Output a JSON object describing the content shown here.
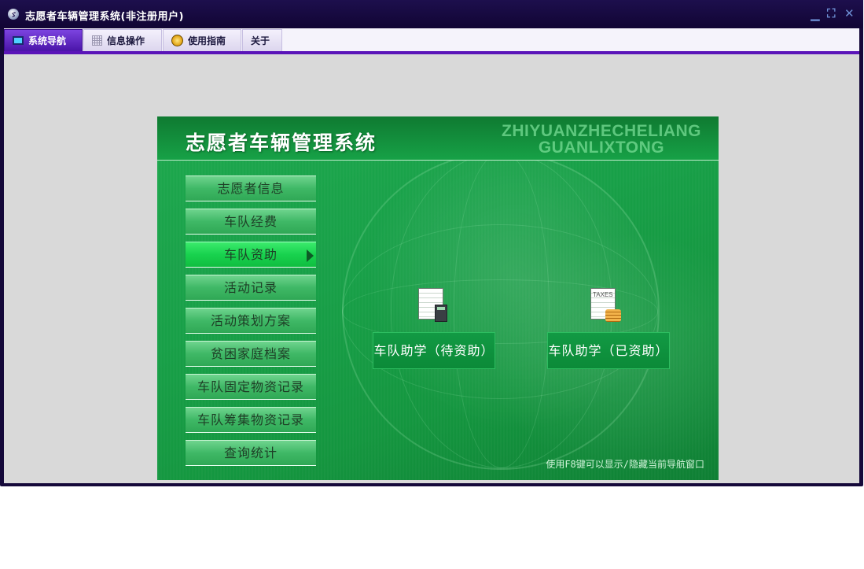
{
  "window": {
    "title": "志愿者车辆管理系统(非注册用户)",
    "app_icon_glyph": "ゞ",
    "controls": {
      "minimize": "▁",
      "restore": "⛶",
      "close": "✕"
    }
  },
  "menubar": {
    "tabs": [
      {
        "label": "系统导航",
        "icon": "monitor-icon",
        "active": true
      },
      {
        "label": "信息操作",
        "icon": "grid-icon",
        "active": false
      },
      {
        "label": "使用指南",
        "icon": "compass-icon",
        "active": false
      },
      {
        "label": "关于",
        "icon": "",
        "active": false
      }
    ],
    "accent_color": "#5a14b8"
  },
  "panel": {
    "title": "志愿者车辆管理系统",
    "pinyin_line1": "ZHIYUANZHECHELIANG",
    "pinyin_line2": "GUANLIXTONG",
    "nav_items": [
      {
        "label": "志愿者信息",
        "active": false
      },
      {
        "label": "车队经费",
        "active": false
      },
      {
        "label": "车队资助",
        "active": true
      },
      {
        "label": "活动记录",
        "active": false
      },
      {
        "label": "活动策划方案",
        "active": false
      },
      {
        "label": "贫困家庭档案",
        "active": false
      },
      {
        "label": "车队固定物资记录",
        "active": false
      },
      {
        "label": "车队筹集物资记录",
        "active": false
      },
      {
        "label": "查询统计",
        "active": false
      }
    ],
    "items": [
      {
        "label": "车队助学（待资助）",
        "icon": "calculator-sheet-icon"
      },
      {
        "label": "车队助学（已资助）",
        "icon": "taxes-sheet-icon",
        "icon_text": "TAXES"
      }
    ],
    "hint": "使用F8键可以显示/隐藏当前导航窗口",
    "colors": {
      "panel_green": "#18a048",
      "active_nav": "#18d24e"
    }
  }
}
